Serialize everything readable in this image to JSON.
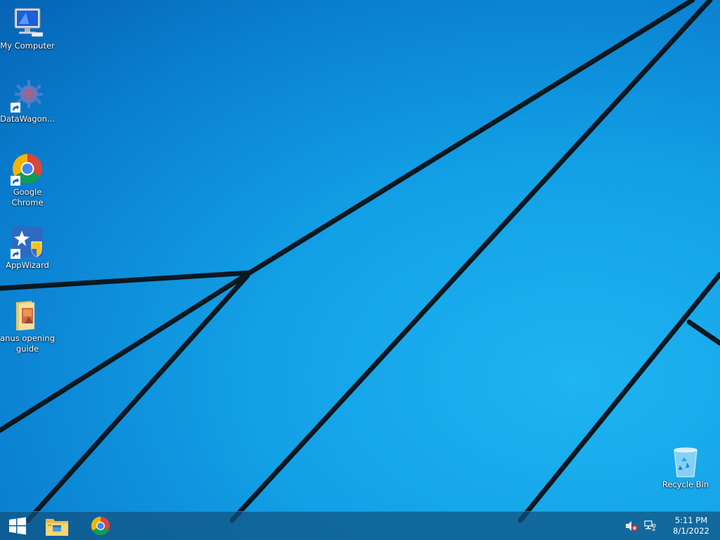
{
  "desktop": {
    "icons": [
      {
        "label": "My Computer",
        "icon": "computer-icon",
        "shortcut": false
      },
      {
        "label": "DataWagon...",
        "icon": "gear-icon",
        "shortcut": true
      },
      {
        "label": "Google Chrome",
        "icon": "chrome-icon",
        "shortcut": true
      },
      {
        "label": "AppWizard",
        "icon": "app-wizard-icon",
        "shortcut": true
      },
      {
        "label": "anus opening guide",
        "icon": "document-folder-icon",
        "shortcut": false
      }
    ],
    "recycle_bin": {
      "label": "Recycle Bin",
      "icon": "recycle-bin-icon"
    },
    "wallpaper": {
      "base_color": "#12a0e6",
      "line_color": "#0a1a22"
    }
  },
  "taskbar": {
    "start": {
      "icon": "windows-logo-icon"
    },
    "pinned": [
      {
        "name": "File Explorer",
        "icon": "file-explorer-icon"
      },
      {
        "name": "Google Chrome",
        "icon": "chrome-icon"
      }
    ],
    "tray": {
      "icons": [
        "volume-muted-icon",
        "network-icon"
      ],
      "time": "5:11 PM",
      "date": "8/1/2022"
    }
  }
}
